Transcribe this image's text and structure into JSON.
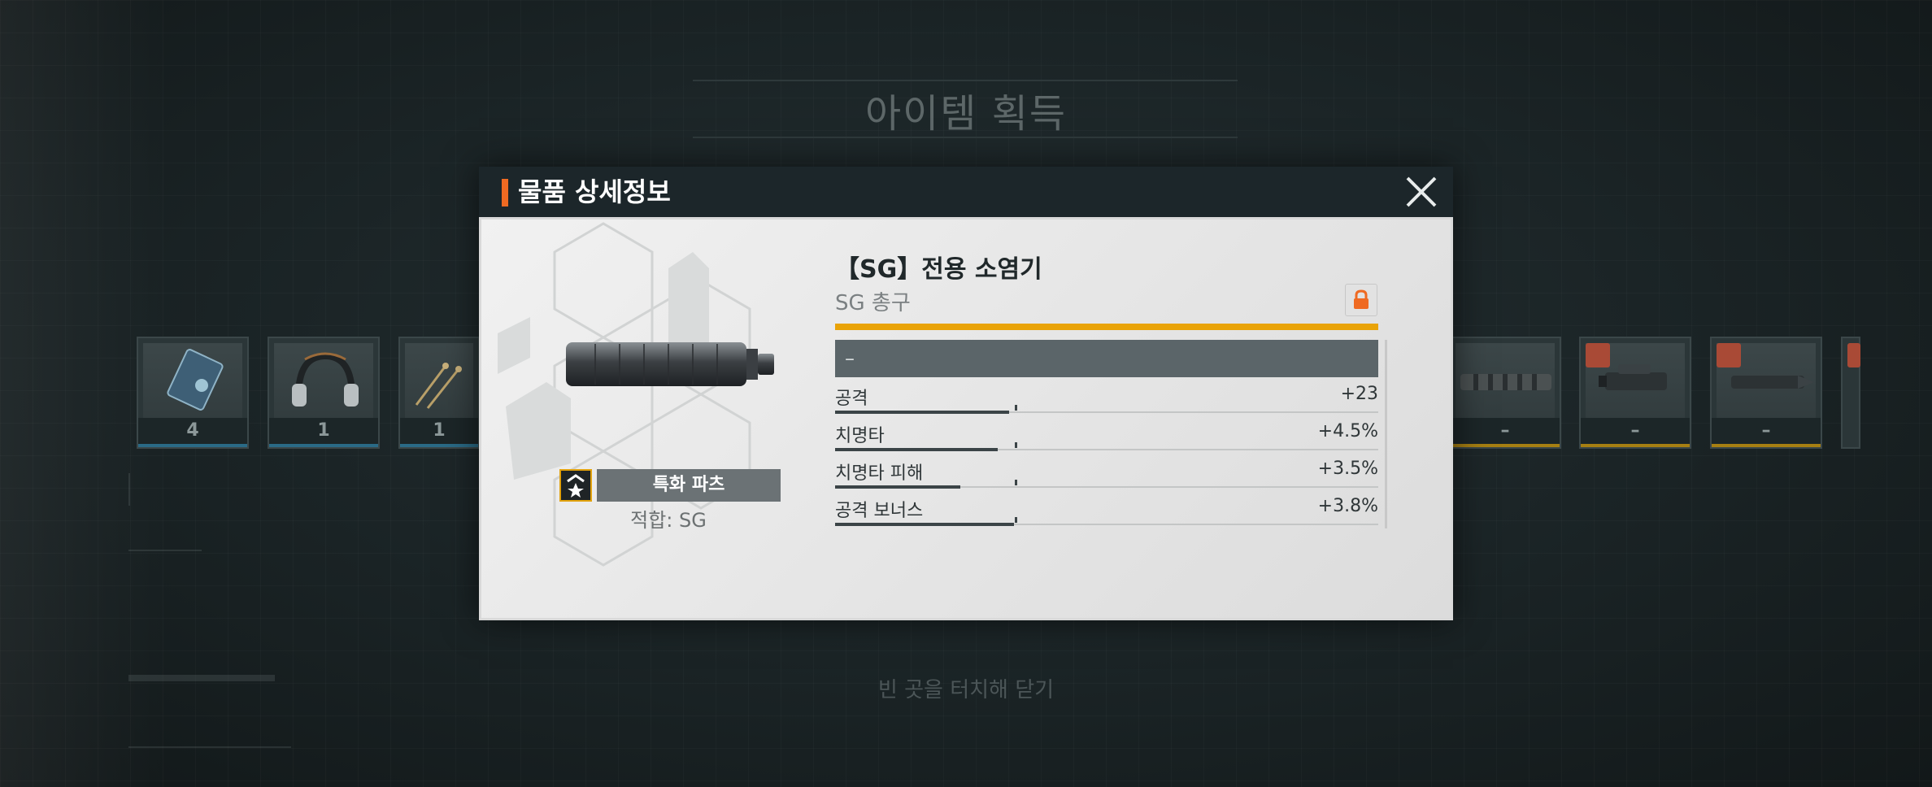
{
  "screen": {
    "title": "아이템 획득",
    "close_hint": "빈 곳을 터치해 닫기"
  },
  "reward_slots": [
    {
      "count": "4",
      "rarity": "blue"
    },
    {
      "count": "1",
      "rarity": "blue"
    },
    {
      "count": "1",
      "rarity": "blue"
    },
    {
      "count": "–",
      "rarity": "gold"
    },
    {
      "count": "–",
      "rarity": "gold"
    },
    {
      "count": "–",
      "rarity": "gold"
    }
  ],
  "modal": {
    "title": "물품 상세정보",
    "item_name": "【SG】전용 소염기",
    "item_type": "SG 총구",
    "specialty_label": "특화 파츠",
    "compatibility": "적합: SG",
    "stat_header": "–",
    "stats": [
      {
        "label": "공격",
        "value": "+23",
        "fill": 0.32
      },
      {
        "label": "치명타",
        "value": "+4.5%",
        "fill": 0.3
      },
      {
        "label": "치명타 피해",
        "value": "+3.5%",
        "fill": 0.23
      },
      {
        "label": "공격 보너스",
        "value": "+3.8%",
        "fill": 0.33
      }
    ]
  },
  "colors": {
    "accent": "#ef6a22",
    "rarity_gold": "#e9a308",
    "header_bg": "#1c262a",
    "lock": "#ef6a22"
  },
  "icons": {
    "close": "close-icon",
    "lock": "lock-icon",
    "specialty": "star-chevron-icon"
  }
}
